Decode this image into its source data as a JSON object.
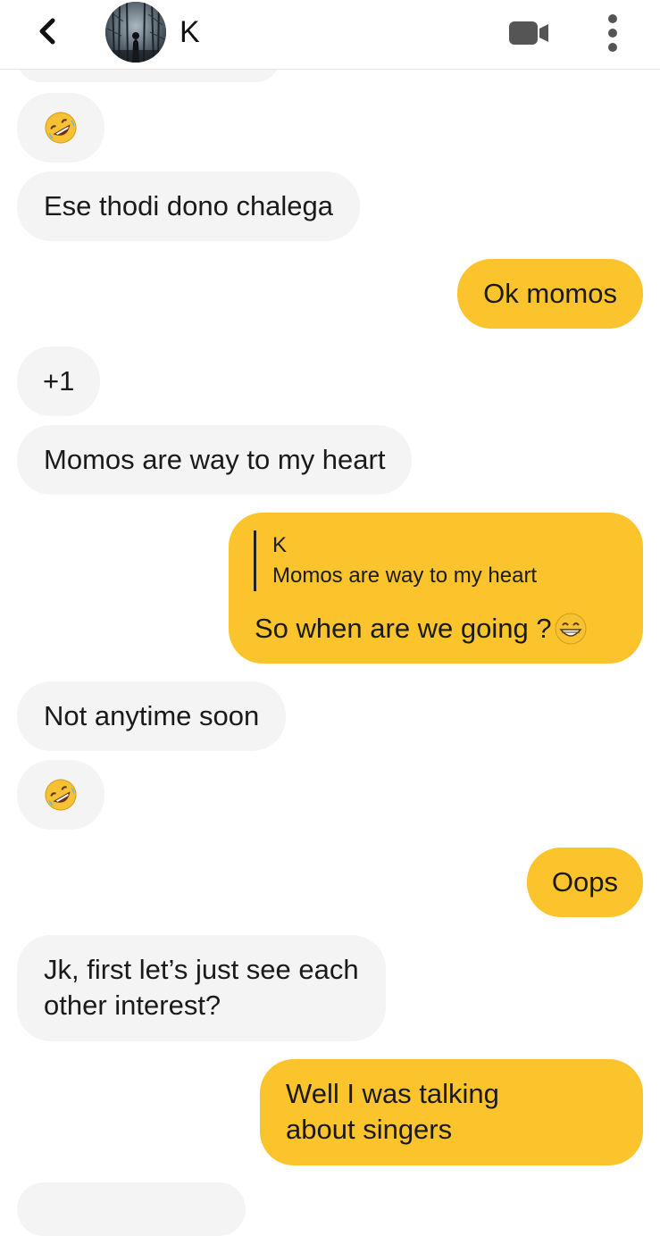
{
  "header": {
    "contact_name": "K",
    "back_icon": "chevron-left-icon",
    "video_icon": "video-camera-icon",
    "more_icon": "more-vertical-icon"
  },
  "colors": {
    "outgoing_bubble": "#fbc42c",
    "incoming_bubble": "#f4f4f4"
  },
  "messages": [
    {
      "direction": "in",
      "type": "emoji",
      "emoji": "rolling-on-floor-laughing"
    },
    {
      "direction": "in",
      "text": "Ese thodi dono chalega"
    },
    {
      "direction": "out",
      "text": "Ok momos"
    },
    {
      "direction": "in",
      "text": "+1"
    },
    {
      "direction": "in",
      "text": "Momos are way to my heart"
    },
    {
      "direction": "out",
      "reply_to": {
        "name": "K",
        "text": "Momos are way to my heart"
      },
      "text": "So when are we going ?",
      "emoji": "grinning-face-with-smiling-eyes"
    },
    {
      "direction": "in",
      "text": "Not anytime soon"
    },
    {
      "direction": "in",
      "type": "emoji",
      "emoji": "rolling-on-floor-laughing"
    },
    {
      "direction": "out",
      "text": "Oops"
    },
    {
      "direction": "in",
      "lines": [
        "Jk, first let’s just see each",
        "other interest?"
      ]
    },
    {
      "direction": "out",
      "lines": [
        "Well I was talking",
        "about singers"
      ]
    }
  ]
}
